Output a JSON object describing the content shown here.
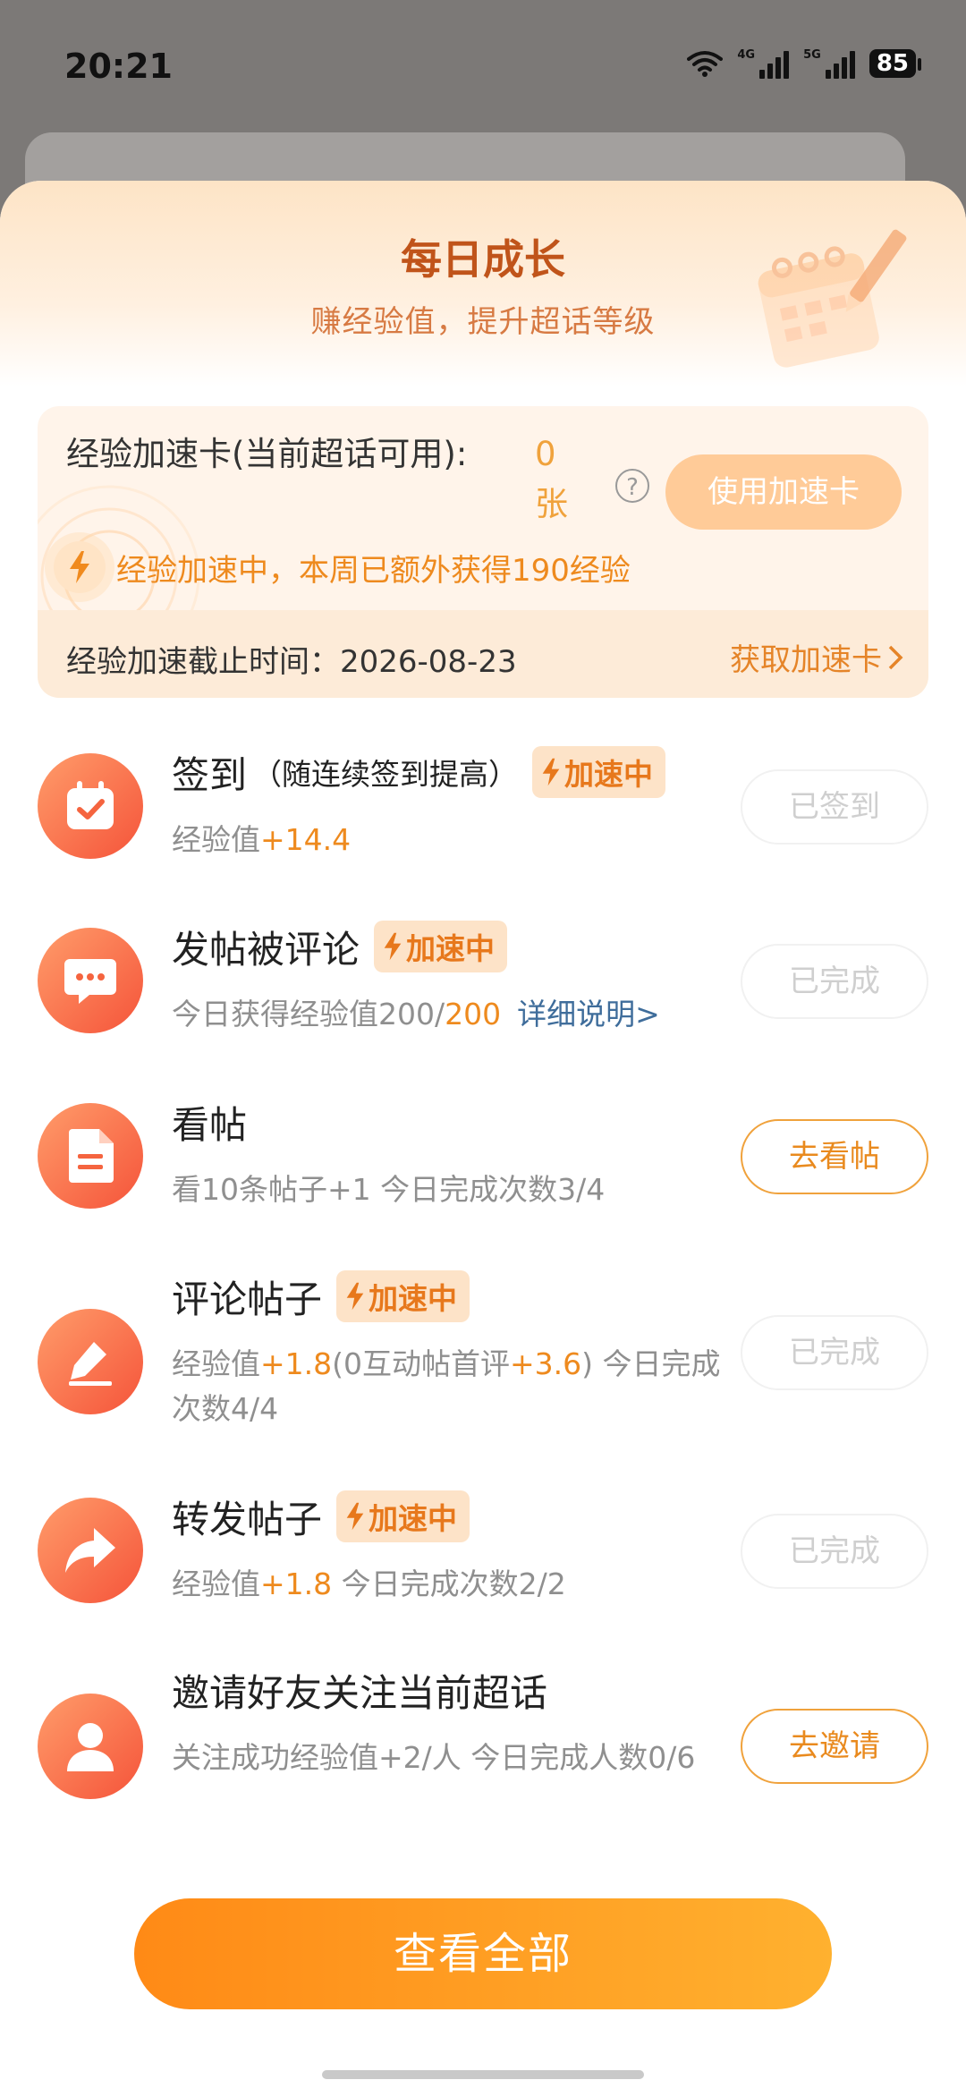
{
  "status_bar": {
    "time": "20:21",
    "net1": "4G",
    "net2": "5G",
    "battery": "85"
  },
  "sheet": {
    "title": "每日成长",
    "subtitle": "赚经验值，提升超话等级"
  },
  "accelerator": {
    "label": "经验加速卡(当前超话可用):",
    "count": "0 张",
    "use_button": "使用加速卡",
    "boost_text": "经验加速中，本周已额外获得190经验",
    "deadline": "经验加速截止时间：2026-08-23",
    "get_link": "获取加速卡"
  },
  "badge_label": "加速中",
  "tasks": [
    {
      "name": "签到",
      "paren": "（随连续签到提高）",
      "desc_prefix": "经验值",
      "desc_hi": "+14.4",
      "button": "已签到",
      "icon": "calendar-check-icon"
    },
    {
      "name": "发帖被评论",
      "desc_prefix": "今日获得经验值200/",
      "desc_hi": "200",
      "desc_link": "详细说明>",
      "button": "已完成",
      "icon": "chat-bubble-icon"
    },
    {
      "name": "看帖",
      "desc": "看10条帖子+1  今日完成次数3/4",
      "button": "去看帖",
      "icon": "document-icon"
    },
    {
      "name": "评论帖子",
      "desc_p1": "经验值",
      "desc_h1": "+1.8",
      "desc_p2": "(0互动帖首评",
      "desc_h2": "+3.6",
      "desc_p3": ")  今日完成次数4/4",
      "button": "已完成",
      "icon": "edit-icon"
    },
    {
      "name": "转发帖子",
      "desc_prefix": "经验值",
      "desc_hi": "+1.8",
      "desc_suffix": "  今日完成次数2/2",
      "button": "已完成",
      "icon": "share-arrow-icon"
    },
    {
      "name": "邀请好友关注当前超话",
      "desc": "关注成功经验值+2/人  今日完成人数0/6",
      "button": "去邀请",
      "icon": "person-icon"
    }
  ],
  "view_all": "查看全部",
  "colors": {
    "accent": "#ff8a16",
    "badge_bg": "#fde3c8",
    "icon_gradient_start": "#ff9c6a",
    "icon_gradient_end": "#f5543a"
  }
}
